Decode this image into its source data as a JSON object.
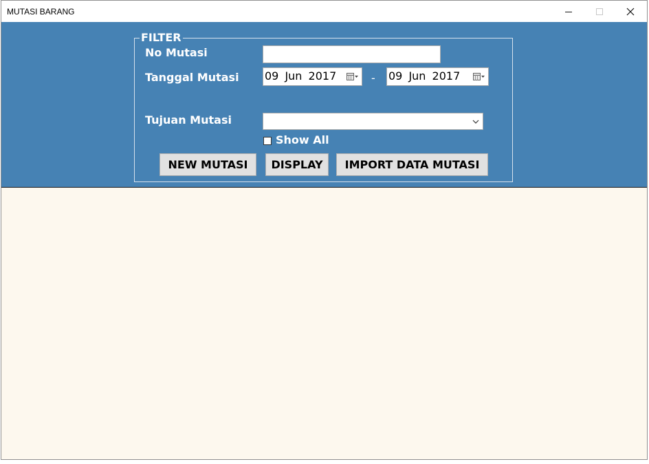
{
  "window": {
    "title": "MUTASI BARANG",
    "controls": [
      "minimize-icon",
      "maximize-icon",
      "close-icon"
    ]
  },
  "filter": {
    "legend": "FILTER",
    "no_mutasi": {
      "label": "No Mutasi",
      "value": ""
    },
    "tanggal": {
      "label": "Tanggal Mutasi",
      "from": "09 Jun 2017",
      "separator": "-",
      "to": "09 Jun 2017"
    },
    "tujuan": {
      "label": "Tujuan Mutasi",
      "selected": ""
    },
    "show_all": {
      "label": "Show All",
      "checked": false
    },
    "buttons": {
      "new": "NEW MUTASI",
      "display": "DISPLAY",
      "import": "IMPORT DATA MUTASI"
    }
  },
  "colors": {
    "panel": "#4682b4",
    "content": "#fdf8ee",
    "button": "#e1e1e1"
  }
}
